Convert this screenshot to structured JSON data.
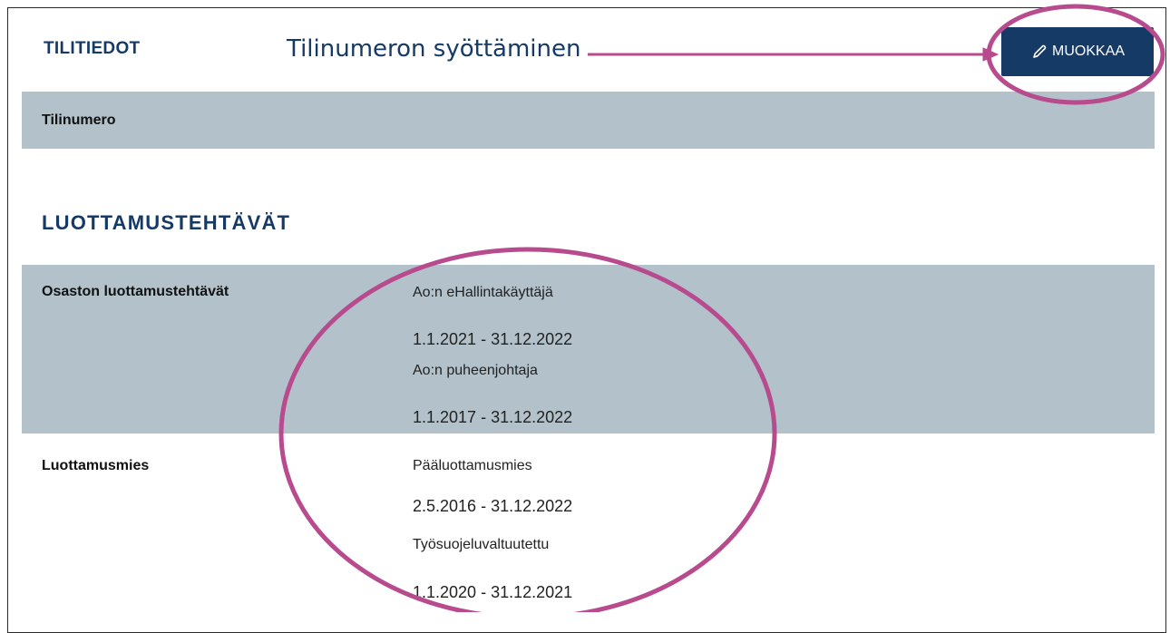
{
  "accent_color": "#b84b8e",
  "brand_color": "#163a66",
  "sections": {
    "account_title": "TILITIEDOT",
    "positions_title": "LUOTTAMUSTEHTÄVÄT"
  },
  "callout_text": "Tilinumeron syöttäminen",
  "edit_button": {
    "label": "MUOKKAA",
    "icon": "pencil-icon"
  },
  "account": {
    "label": "Tilinumero"
  },
  "positions": [
    {
      "label": "Osaston luottamustehtävät",
      "items": [
        {
          "title": "Ao:n eHallintakäyttäjä",
          "period": "1.1.2021 - 31.12.2022"
        },
        {
          "title": "Ao:n puheenjohtaja",
          "period": "1.1.2017 - 31.12.2022"
        }
      ]
    },
    {
      "label": "Luottamusmies",
      "items": [
        {
          "title": "Pääluottamusmies",
          "period": "2.5.2016 - 31.12.2022"
        },
        {
          "title": "Työsuojeluvaltuutettu",
          "period": "1.1.2020 - 31.12.2021"
        }
      ]
    }
  ]
}
